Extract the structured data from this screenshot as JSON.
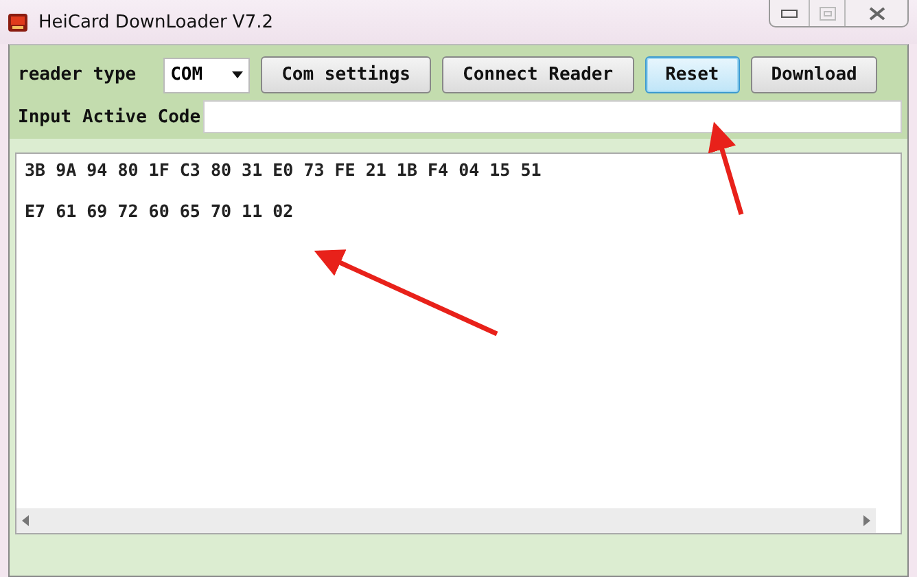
{
  "window": {
    "title": "HeiCard DownLoader V7.2"
  },
  "reader_type": {
    "label": "reader type",
    "value": "COM"
  },
  "buttons": [
    {
      "label": "Com settings",
      "highlighted": false
    },
    {
      "label": "Connect Reader",
      "highlighted": false
    },
    {
      "label": "Reset",
      "highlighted": true
    },
    {
      "label": "Download",
      "highlighted": false
    }
  ],
  "active_code": {
    "label": "Input Active Code"
  },
  "output_lines": [
    "3B 9A 94 80 1F C3 80 31 E0 73 FE 21 1B F4 04 15 51",
    "E7 61 69 72 60 65 70 11 02"
  ]
}
